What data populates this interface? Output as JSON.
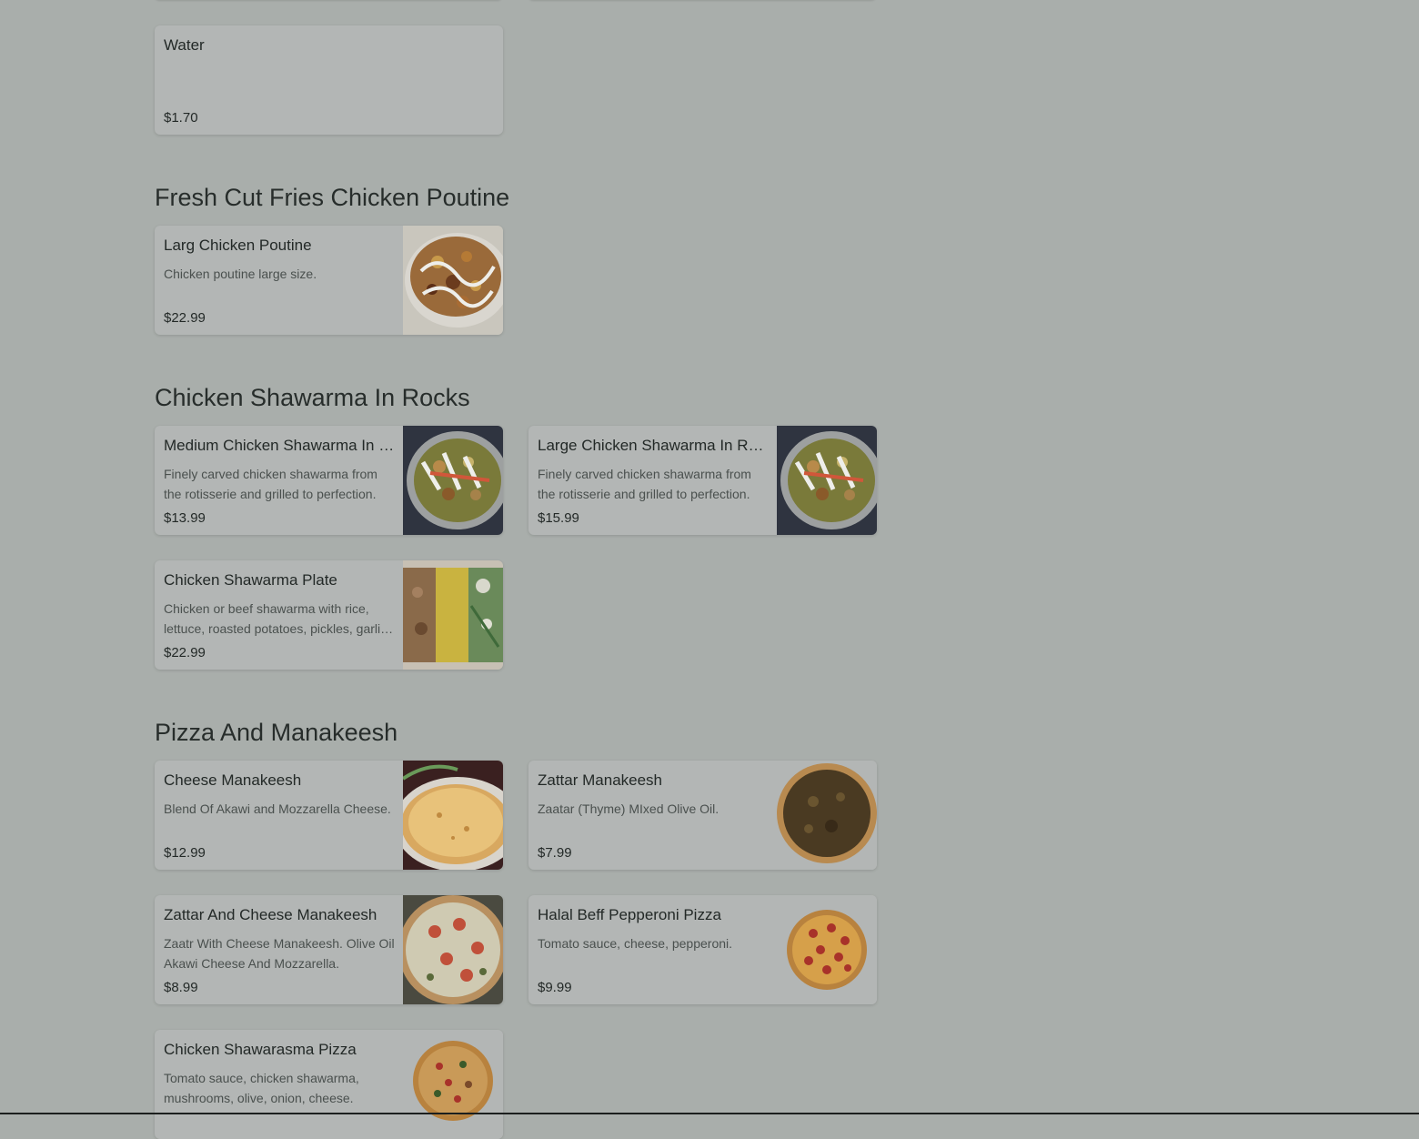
{
  "sections": {
    "drinks": {
      "items": [
        {
          "name": "Water",
          "description": "",
          "price": "$1.70"
        }
      ]
    },
    "poutine": {
      "title": "Fresh Cut Fries Chicken Poutine",
      "items": [
        {
          "name": "Larg Chicken Poutine",
          "description": "Chicken poutine large size.",
          "price": "$22.99",
          "image": "poutine-bowl-image"
        }
      ]
    },
    "rocks": {
      "title": "Chicken Shawarma In Rocks",
      "items": [
        {
          "name": "Medium Chicken Shawarma In Rocks",
          "description": "Finely carved chicken shawarma from the rotisserie and grilled to perfection.",
          "price": "$13.99",
          "image": "shawarma-rocks-image"
        },
        {
          "name": "Large Chicken Shawarma In Rocks",
          "description": "Finely carved chicken shawarma from the rotisserie and grilled to perfection.",
          "price": "$15.99",
          "image": "shawarma-rocks-image"
        },
        {
          "name": "Chicken Shawarma Plate",
          "description": "Chicken or beef shawarma with rice, lettuce, roasted potatoes, pickles, garlic sauce.",
          "price": "$22.99",
          "image": "shawarma-plate-image"
        }
      ]
    },
    "pizza": {
      "title": "Pizza And Manakeesh",
      "items": [
        {
          "name": "Cheese Manakeesh",
          "description": "Blend Of Akawi and Mozzarella Cheese.",
          "price": "$12.99",
          "image": "cheese-manakeesh-image"
        },
        {
          "name": "Zattar Manakeesh",
          "description": "Zaatar (Thyme) MIxed Olive Oil.",
          "price": "$7.99",
          "image": "zaatar-manakeesh-image"
        },
        {
          "name": "Zattar And Cheese Manakeesh",
          "description": "Zaatr With Cheese Manakeesh. Olive Oil Akawi Cheese And Mozzarella.",
          "price": "$8.99",
          "image": "zaatar-cheese-image"
        },
        {
          "name": "Halal Beff Pepperoni Pizza",
          "description": "Tomato sauce, cheese, pepperoni.",
          "price": "$9.99",
          "image": "pepperoni-pizza-image"
        },
        {
          "name": "Chicken Shawarasma Pizza",
          "description": "Tomato sauce, chicken shawarma, mushrooms, olive, onion, cheese.",
          "price": "",
          "image": "shawarma-pizza-image"
        }
      ]
    }
  },
  "colors": {
    "background": "#a9aeab",
    "card": "#b3b6b5",
    "text": "#232927",
    "muted_text": "#4a504e"
  }
}
